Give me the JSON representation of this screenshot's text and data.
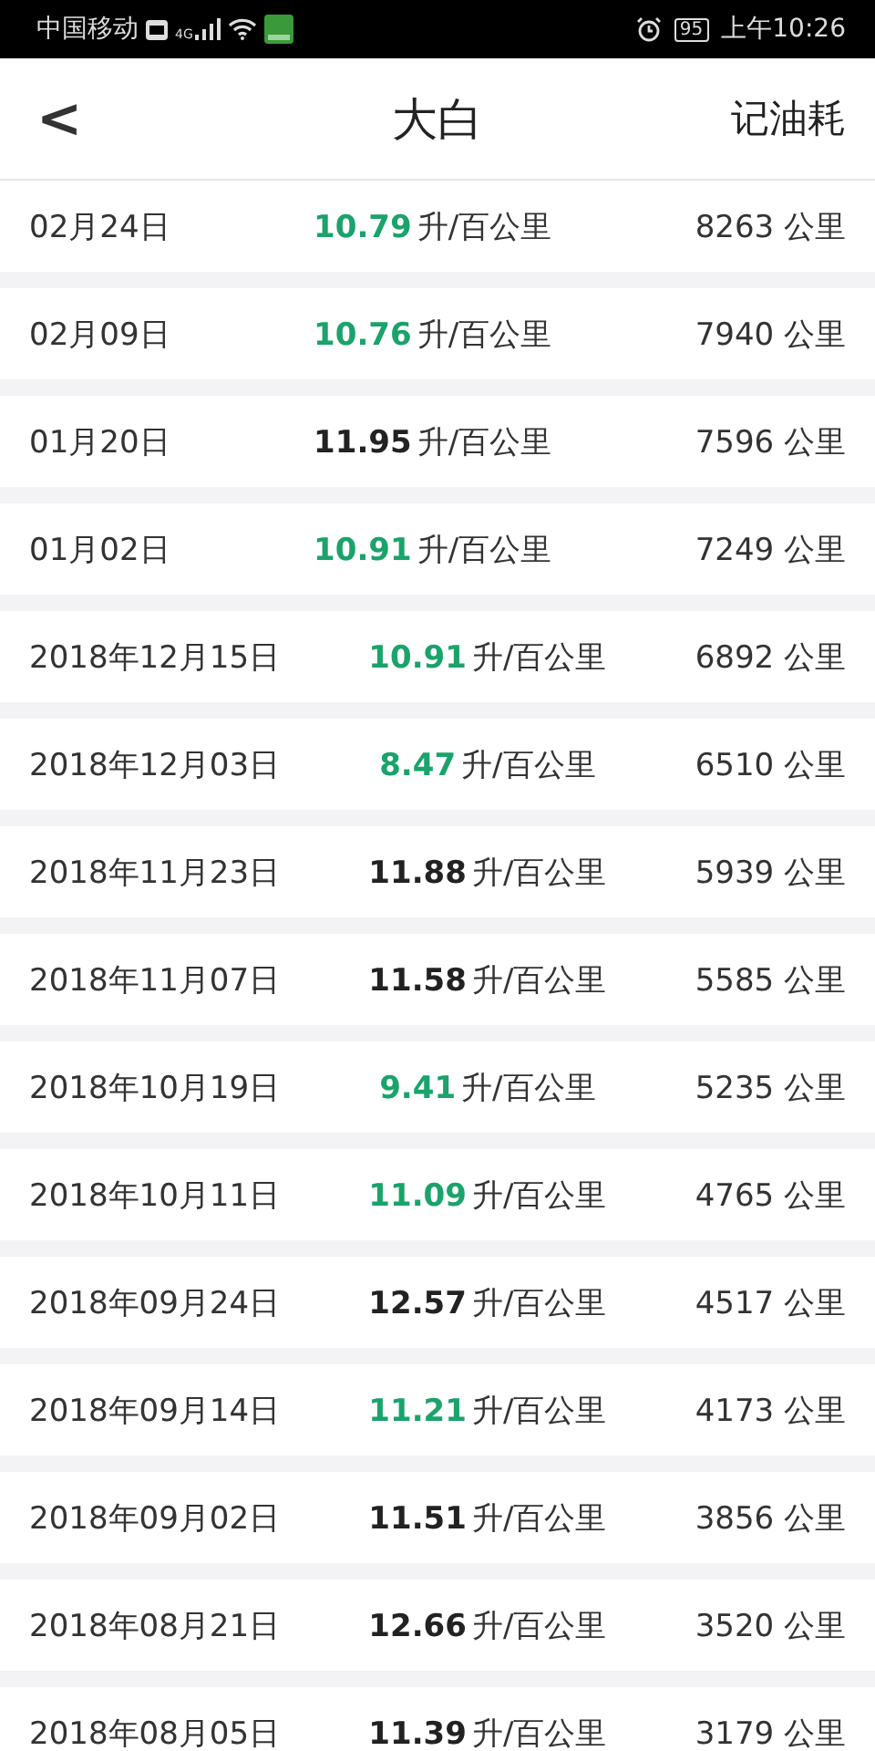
{
  "status_bar": {
    "carrier": "中国移动",
    "network": "4G",
    "battery": "95",
    "time": "上午10:26"
  },
  "header": {
    "back": "<",
    "title": "大白",
    "action": "记油耗"
  },
  "records": [
    {
      "date": "02月24日",
      "consumption": "10.79",
      "unit": "升/百公里",
      "color": "#1aa36b",
      "odometer": "8263 公里"
    },
    {
      "date": "02月09日",
      "consumption": "10.76",
      "unit": "升/百公里",
      "color": "#1aa36b",
      "odometer": "7940 公里"
    },
    {
      "date": "01月20日",
      "consumption": "11.95",
      "unit": "升/百公里",
      "color": "#222222",
      "odometer": "7596 公里"
    },
    {
      "date": "01月02日",
      "consumption": "10.91",
      "unit": "升/百公里",
      "color": "#1aa36b",
      "odometer": "7249 公里"
    },
    {
      "date": "2018年12月15日",
      "consumption": "10.91",
      "unit": "升/百公里",
      "color": "#1aa36b",
      "odometer": "6892 公里"
    },
    {
      "date": "2018年12月03日",
      "consumption": "8.47",
      "unit": "升/百公里",
      "color": "#1aa36b",
      "odometer": "6510 公里"
    },
    {
      "date": "2018年11月23日",
      "consumption": "11.88",
      "unit": "升/百公里",
      "color": "#222222",
      "odometer": "5939 公里"
    },
    {
      "date": "2018年11月07日",
      "consumption": "11.58",
      "unit": "升/百公里",
      "color": "#222222",
      "odometer": "5585 公里"
    },
    {
      "date": "2018年10月19日",
      "consumption": "9.41",
      "unit": "升/百公里",
      "color": "#1aa36b",
      "odometer": "5235 公里"
    },
    {
      "date": "2018年10月11日",
      "consumption": "11.09",
      "unit": "升/百公里",
      "color": "#1aa36b",
      "odometer": "4765 公里"
    },
    {
      "date": "2018年09月24日",
      "consumption": "12.57",
      "unit": "升/百公里",
      "color": "#222222",
      "odometer": "4517 公里"
    },
    {
      "date": "2018年09月14日",
      "consumption": "11.21",
      "unit": "升/百公里",
      "color": "#1aa36b",
      "odometer": "4173 公里"
    },
    {
      "date": "2018年09月02日",
      "consumption": "11.51",
      "unit": "升/百公里",
      "color": "#222222",
      "odometer": "3856 公里"
    },
    {
      "date": "2018年08月21日",
      "consumption": "12.66",
      "unit": "升/百公里",
      "color": "#222222",
      "odometer": "3520 公里"
    },
    {
      "date": "2018年08月05日",
      "consumption": "11.39",
      "unit": "升/百公里",
      "color": "#222222",
      "odometer": "3179 公里"
    }
  ]
}
